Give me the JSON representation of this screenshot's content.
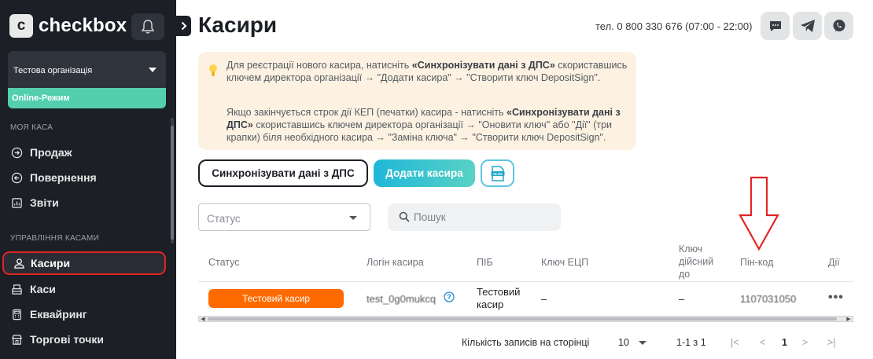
{
  "app": {
    "logo_letter": "c",
    "logo_name": "checkbox"
  },
  "sidebar": {
    "org_name": "Тестова організація",
    "mode": "Online-Режим",
    "section_my_kasa": "МОЯ КАСА",
    "section_manage": "УПРАВЛІННЯ КАСАМИ",
    "items": [
      {
        "label": "Продаж",
        "icon": "sale-icon"
      },
      {
        "label": "Повернення",
        "icon": "return-icon"
      },
      {
        "label": "Звіти",
        "icon": "reports-icon"
      },
      {
        "label": "Касири",
        "icon": "cashiers-icon"
      },
      {
        "label": "Каси",
        "icon": "registers-icon"
      },
      {
        "label": "Еквайринг",
        "icon": "acquiring-icon"
      },
      {
        "label": "Торгові точки",
        "icon": "stores-icon"
      }
    ],
    "active_item": "Касири"
  },
  "header": {
    "title": "Касири",
    "phone": "тел. 0 800 330 676 (07:00 - 22:00)"
  },
  "info": {
    "p1_a": "Для реєстрації нового касира, натисніть ",
    "p1_b": "«Синхронізувати дані з ДПС»",
    "p1_c": " скориставшись ключем директора організації → \"Додати касира\" → \"Створити ключ DepositSign\".",
    "p2_a": "Якщо закінчується строк дії КЕП (печатки) касира - натисніть ",
    "p2_b": "«Синхронізувати дані з ДПС»",
    "p2_c": " скориставшись ключем директора організації → \"Оновити ключ\" або \"Дії\" (три крапки) біля необхідного касира → \"Заміна ключа\" → \"Створити ключ DepositSign\"."
  },
  "actions": {
    "sync_label": "Синхронізувати дані з ДПС",
    "add_label": "Додати касира",
    "xls_label": "XLSX"
  },
  "filters": {
    "status_placeholder": "Статус",
    "search_placeholder": "Пошук"
  },
  "table": {
    "headers": {
      "status": "Статус",
      "login": "Логін касира",
      "name": "ПІБ",
      "key": "Ключ ЕЦП",
      "valid_l1": "Ключ",
      "valid_l2": "дійсний",
      "valid_l3": "до",
      "pin": "Пін-код",
      "actions": "Дії"
    },
    "rows": [
      {
        "status": "Тестовий касир",
        "login": "test_0g0mukcq",
        "name_l1": "Тестовий",
        "name_l2": "касир",
        "key": "–",
        "valid": "–",
        "pin": "1107031050",
        "actions": "•••"
      }
    ]
  },
  "pagination": {
    "per_page_label": "Кількість записів на сторінці",
    "per_page": "10",
    "range": "1-1 з 1",
    "first": "|<",
    "prev": "<",
    "page": "1",
    "next": ">",
    "last": ">|"
  },
  "colors": {
    "sidebar_bg": "#1c1f26",
    "accent_green": "#54cfae",
    "accent_blue": "#1fb7d8",
    "badge_orange": "#ff6a00",
    "annotation_red": "#e02424"
  }
}
